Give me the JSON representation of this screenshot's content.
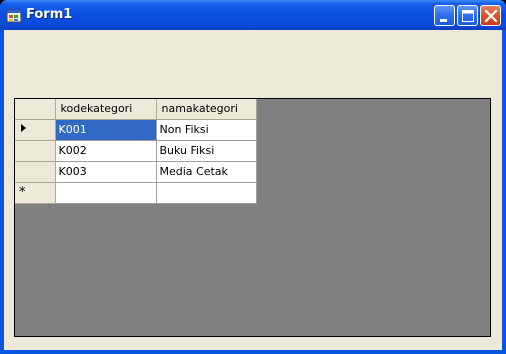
{
  "window": {
    "title": "Form1",
    "icon": "windows-form-icon",
    "controls": [
      "minimize-icon",
      "maximize-icon",
      "close-icon"
    ]
  },
  "grid": {
    "columns": [
      "kodekategori",
      "namakategori"
    ],
    "rows": [
      {
        "kodekategori": "K001",
        "namakategori": "Non Fiksi",
        "indicator": "current-row-arrow"
      },
      {
        "kodekategori": "K002",
        "namakategori": "Buku Fiksi",
        "indicator": ""
      },
      {
        "kodekategori": "K003",
        "namakategori": "Media Cetak",
        "indicator": ""
      }
    ],
    "new_row_indicator": "*",
    "selected_cell": {
      "row": 0,
      "column": "kodekategori"
    },
    "colors": {
      "selection": "#316ac5",
      "background": "#808080",
      "header": "#ece9d8"
    }
  }
}
